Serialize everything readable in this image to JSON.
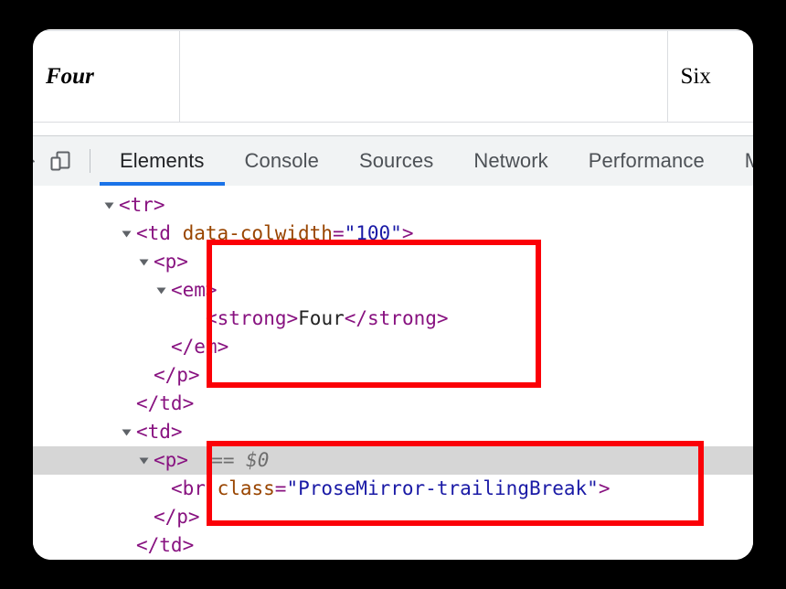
{
  "window": {
    "page": {
      "table": {
        "rows": [
          {
            "cells": [
              {
                "text": "Four",
                "style": "bold-italic"
              },
              {
                "text": "",
                "style": "plain"
              },
              {
                "text": "Six",
                "style": "plain"
              }
            ]
          }
        ]
      }
    },
    "devtools": {
      "toolbar": {
        "icons": [
          {
            "name": "inspect-element-icon",
            "glyph": "inspect"
          },
          {
            "name": "device-toolbar-icon",
            "glyph": "device"
          }
        ],
        "tabs": [
          {
            "label": "Elements",
            "active": true
          },
          {
            "label": "Console",
            "active": false
          },
          {
            "label": "Sources",
            "active": false
          },
          {
            "label": "Network",
            "active": false
          },
          {
            "label": "Performance",
            "active": false
          },
          {
            "label": "Me",
            "active": false
          }
        ]
      },
      "dom_tree": {
        "rows": [
          {
            "indent": 4,
            "twisty": true,
            "selected": false,
            "parts": [
              {
                "t": "tag",
                "v": "<tr>"
              }
            ]
          },
          {
            "indent": 5,
            "twisty": true,
            "selected": false,
            "parts": [
              {
                "t": "tag",
                "v": "<td "
              },
              {
                "t": "attrname",
                "v": "data-colwidth"
              },
              {
                "t": "tag",
                "v": "="
              },
              {
                "t": "attrval",
                "v": "\"100\""
              },
              {
                "t": "tag",
                "v": ">"
              }
            ]
          },
          {
            "indent": 6,
            "twisty": true,
            "selected": false,
            "parts": [
              {
                "t": "tag",
                "v": "<p>"
              }
            ]
          },
          {
            "indent": 7,
            "twisty": true,
            "selected": false,
            "parts": [
              {
                "t": "tag",
                "v": "<em>"
              }
            ]
          },
          {
            "indent": 9,
            "twisty": false,
            "selected": false,
            "parts": [
              {
                "t": "tag",
                "v": "<strong>"
              },
              {
                "t": "txtnode",
                "v": "Four"
              },
              {
                "t": "tag",
                "v": "</strong>"
              }
            ]
          },
          {
            "indent": 7,
            "twisty": false,
            "selected": false,
            "parts": [
              {
                "t": "tag",
                "v": "</em>"
              }
            ]
          },
          {
            "indent": 6,
            "twisty": false,
            "selected": false,
            "parts": [
              {
                "t": "tag",
                "v": "</p>"
              }
            ]
          },
          {
            "indent": 5,
            "twisty": false,
            "selected": false,
            "parts": [
              {
                "t": "tag",
                "v": "</td>"
              }
            ]
          },
          {
            "indent": 5,
            "twisty": true,
            "selected": false,
            "parts": [
              {
                "t": "tag",
                "v": "<td>"
              }
            ]
          },
          {
            "indent": 6,
            "twisty": true,
            "selected": true,
            "parts": [
              {
                "t": "tag",
                "v": "<p>"
              },
              {
                "t": "sel0",
                "v": "  == $0"
              }
            ]
          },
          {
            "indent": 7,
            "twisty": false,
            "selected": false,
            "parts": [
              {
                "t": "tag",
                "v": "<br "
              },
              {
                "t": "attrname",
                "v": "class"
              },
              {
                "t": "tag",
                "v": "="
              },
              {
                "t": "attrval",
                "v": "\"ProseMirror-trailingBreak\""
              },
              {
                "t": "tag",
                "v": ">"
              }
            ]
          },
          {
            "indent": 6,
            "twisty": false,
            "selected": false,
            "parts": [
              {
                "t": "tag",
                "v": "</p>"
              }
            ]
          },
          {
            "indent": 5,
            "twisty": false,
            "selected": false,
            "parts": [
              {
                "t": "tag",
                "v": "</td>"
              }
            ]
          }
        ]
      }
    }
  },
  "annotations": [
    {
      "name": "highlight-box-paragraph-four",
      "color": "#fb0007"
    },
    {
      "name": "highlight-box-paragraph-empty",
      "color": "#fb0007"
    }
  ],
  "colors": {
    "accent": "#1a73e8",
    "annotation": "#fb0007",
    "selected_row": "#d6d6d6",
    "toolbar_bg": "#f1f3f4",
    "tag": "#881280",
    "attr_name": "#994500",
    "attr_value": "#1a1aa6"
  }
}
